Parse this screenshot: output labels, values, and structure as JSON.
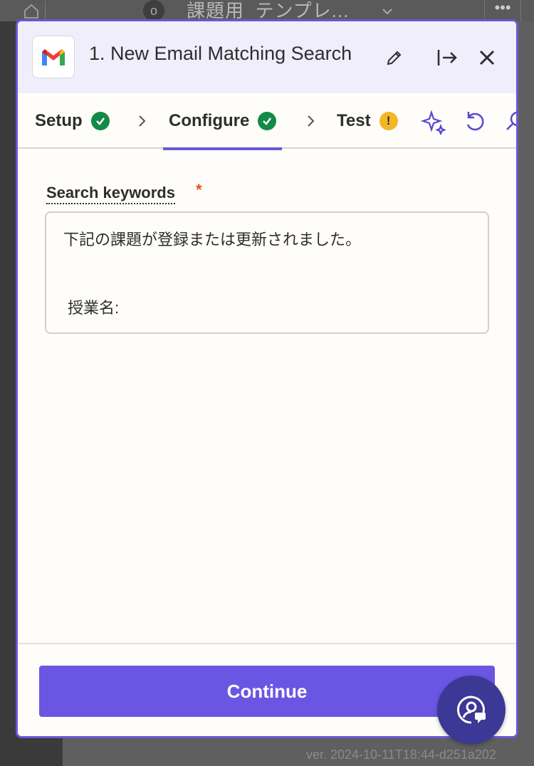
{
  "background": {
    "zap_title": "課題用_テンプレ...",
    "node_label": "o",
    "more_label": "•••",
    "version": "ver. 2024-10-11T18:44-d251a202"
  },
  "panel": {
    "step_title": "1. New Email Matching Search",
    "tabs": [
      {
        "label": "Setup",
        "status": "complete"
      },
      {
        "label": "Configure",
        "status": "complete",
        "active": true
      },
      {
        "label": "Test",
        "status": "warning"
      }
    ],
    "warning_glyph": "!",
    "field": {
      "label": "Search keywords",
      "required_mark": "*",
      "line1": "下記の課題が登録または更新されました。",
      "line2": "授業名:"
    },
    "continue_label": "Continue"
  },
  "colors": {
    "accent": "#6b56d6",
    "button": "#6b56e3",
    "success": "#138a45",
    "warning": "#f4b626",
    "required": "#e5521a",
    "fab": "#3c3896"
  },
  "icons": [
    "home-icon",
    "gmail-logo",
    "pencil-icon",
    "expand-panel-icon",
    "close-icon",
    "check-icon",
    "chevron-right-icon",
    "ai-sparkle-icon",
    "undo-icon",
    "search-icon",
    "help-chat-icon"
  ]
}
